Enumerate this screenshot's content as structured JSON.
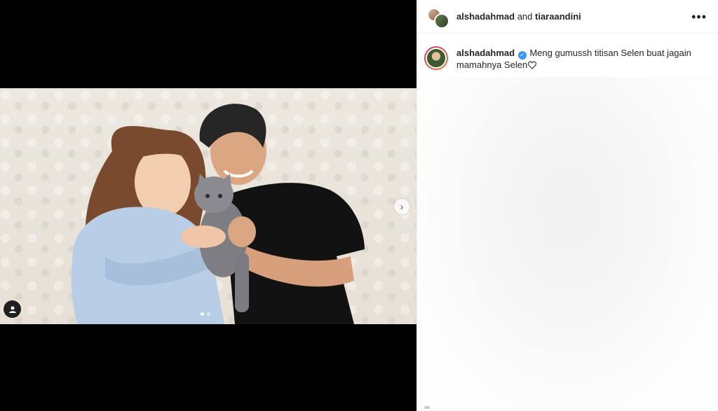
{
  "header": {
    "user1": "alshadahmad",
    "connector": " and ",
    "user2": "tiaraandini",
    "more_icon": "more-horizontal-icon"
  },
  "caption": {
    "username": "alshadahmad",
    "verified_icon": "verified-badge-icon",
    "text": "Meng gumussh titisan Selen buat jagain mamahnya Selen",
    "trailing_icon": "heart-outline-icon"
  },
  "media": {
    "next_icon": "chevron-right-icon",
    "tag_icon": "user-tag-icon",
    "carousel_count": 2,
    "carousel_active": 0
  },
  "colors": {
    "verified": "#3897f0",
    "story_ring_start": "#c43a68",
    "story_ring_end": "#e07b39"
  }
}
